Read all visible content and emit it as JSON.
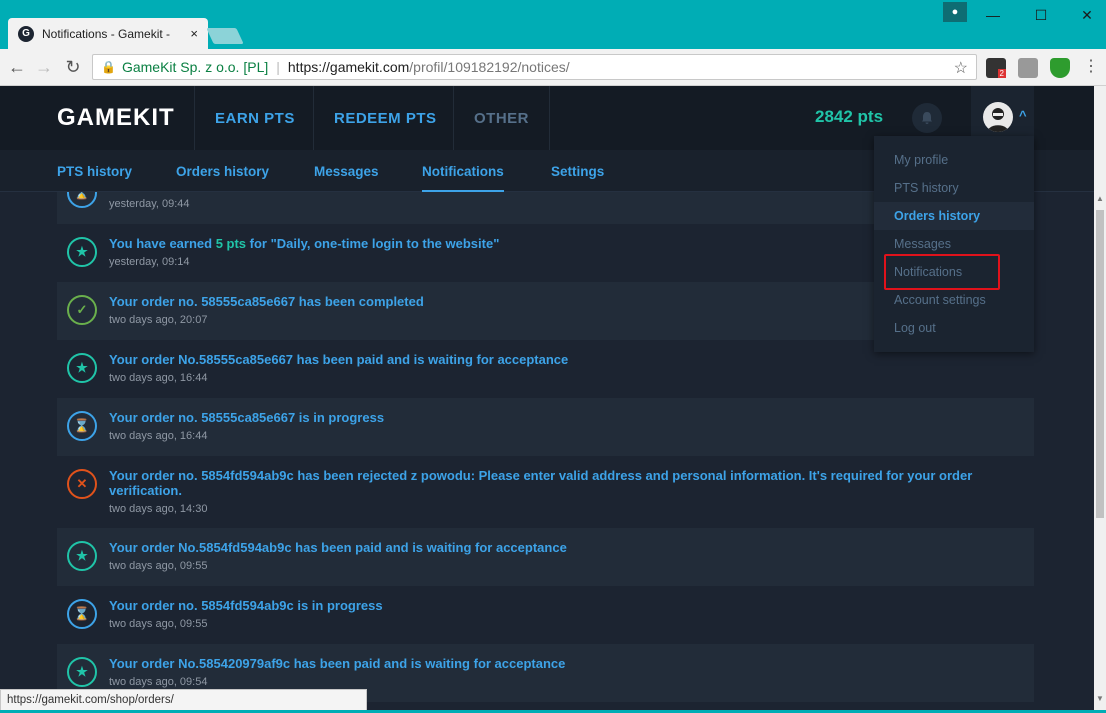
{
  "browser": {
    "tab_title": "Notifications - Gamekit -",
    "tab_close": "×",
    "secure_label": "GameKit Sp. z o.o. [PL]",
    "url_host": "https://gamekit.com",
    "url_path": "/profil/109182192/notices/",
    "status_url": "https://gamekit.com/shop/orders/",
    "extension_badge": "2"
  },
  "header": {
    "logo": "GAMEKIT",
    "nav": [
      "EARN PTS",
      "REDEEM PTS",
      "OTHER"
    ],
    "points": "2842 pts"
  },
  "subnav": {
    "tabs": [
      "PTS history",
      "Orders history",
      "Messages",
      "Notifications",
      "Settings"
    ],
    "active": "Notifications"
  },
  "notifications": [
    {
      "icon": "hourglass-icon",
      "message": "",
      "time": "yesterday, 09:44"
    },
    {
      "icon": "star-circle-icon",
      "message_prefix": "You have earned ",
      "message_highlight": "5 pts",
      "message_suffix": " for \"Daily, one-time login to the website\"",
      "time": "yesterday, 09:14"
    },
    {
      "icon": "check-circle-icon",
      "message": "Your order no. 58555ca85e667 has been completed",
      "time": "two days ago, 20:07"
    },
    {
      "icon": "star-circle-icon",
      "message": "Your order No.58555ca85e667 has been paid and is waiting for acceptance",
      "time": "two days ago, 16:44"
    },
    {
      "icon": "hourglass-icon",
      "message": "Your order no. 58555ca85e667 is in progress",
      "time": "two days ago, 16:44"
    },
    {
      "icon": "cross-circle-icon",
      "message": "Your order no. 5854fd594ab9c has been rejected z powodu: Please enter valid address and personal information. It's required for your order verification.",
      "time": "two days ago, 14:30"
    },
    {
      "icon": "star-circle-icon",
      "message": "Your order No.5854fd594ab9c has been paid and is waiting for acceptance",
      "time": "two days ago, 09:55"
    },
    {
      "icon": "hourglass-icon",
      "message": "Your order no. 5854fd594ab9c is in progress",
      "time": "two days ago, 09:55"
    },
    {
      "icon": "star-circle-icon",
      "message": "Your order No.585420979af9c has been paid and is waiting for acceptance",
      "time": "two days ago, 09:54"
    }
  ],
  "dropdown": {
    "items": [
      "My profile",
      "PTS history",
      "Orders history",
      "Messages",
      "Notifications",
      "Account settings",
      "Log out"
    ],
    "hovered": "Orders history"
  },
  "colors": {
    "accent_blue": "#3da3e8",
    "accent_green": "#20c4a8",
    "error_red": "#e0521b",
    "success_green": "#6ab04c",
    "browser_teal": "#00adb5"
  }
}
